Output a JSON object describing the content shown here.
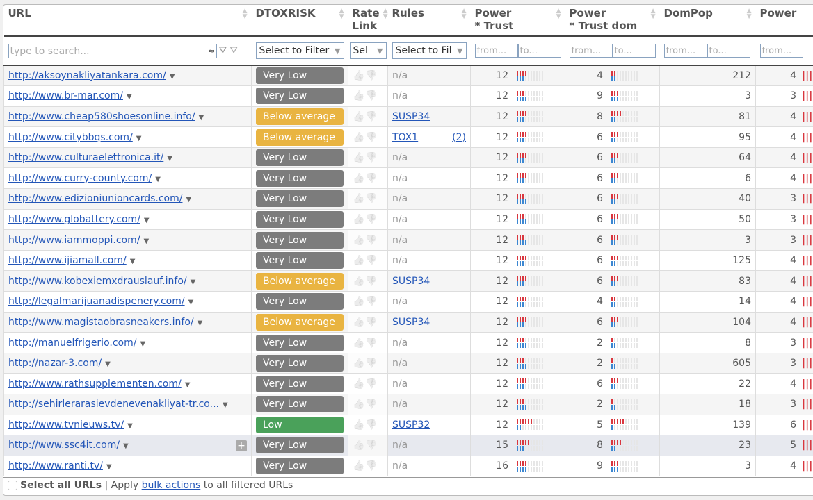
{
  "colors": {
    "very_low": "#7c7c7c",
    "below_average": "#e9b441",
    "low": "#4aa15a",
    "meter_red": "#d9363e",
    "meter_blue": "#3b86d1"
  },
  "columns": [
    "URL",
    "DTOXRISK",
    "Rate\nLink",
    "Rules",
    "Power\n* Trust",
    "Power\n* Trust dom",
    "DomPop",
    "Power"
  ],
  "filters": {
    "search_placeholder": "type to search...",
    "approx_icon": "≈",
    "select_filter": "Select to Filter",
    "select_short": "Sel",
    "select_rules": "Select to Fil",
    "from": "from...",
    "to": "to..."
  },
  "rows": [
    {
      "url": "http://aksoynakliyatankara.com/",
      "risk": "Very Low",
      "level": "very_low",
      "rules": "n/a",
      "pt": 12,
      "pt_r": 4,
      "pt_b": 3,
      "ptd": 4,
      "ptd_r": 2,
      "ptd_b": 2,
      "dompop": 212,
      "power": 4
    },
    {
      "url": "http://www.br-mar.com/",
      "risk": "Very Low",
      "level": "very_low",
      "rules": "n/a",
      "pt": 12,
      "pt_r": 3,
      "pt_b": 4,
      "ptd": 9,
      "ptd_r": 3,
      "ptd_b": 3,
      "dompop": 3,
      "power": 3
    },
    {
      "url": "http://www.cheap580shoesonline.info/",
      "risk": "Below average",
      "level": "below_average",
      "rules": "SUSP34",
      "pt": 12,
      "pt_r": 4,
      "pt_b": 3,
      "ptd": 8,
      "ptd_r": 4,
      "ptd_b": 2,
      "dompop": 81,
      "power": 4
    },
    {
      "url": "http://www.citybbqs.com/",
      "risk": "Below average",
      "level": "below_average",
      "rules": "TOX1",
      "rules_count": "(2)",
      "pt": 12,
      "pt_r": 4,
      "pt_b": 3,
      "ptd": 6,
      "ptd_r": 3,
      "ptd_b": 2,
      "dompop": 95,
      "power": 4
    },
    {
      "url": "http://www.culturaelettronica.it/",
      "risk": "Very Low",
      "level": "very_low",
      "rules": "n/a",
      "pt": 12,
      "pt_r": 4,
      "pt_b": 3,
      "ptd": 6,
      "ptd_r": 3,
      "ptd_b": 2,
      "dompop": 64,
      "power": 4
    },
    {
      "url": "http://www.curry-county.com/",
      "risk": "Very Low",
      "level": "very_low",
      "rules": "n/a",
      "pt": 12,
      "pt_r": 4,
      "pt_b": 3,
      "ptd": 6,
      "ptd_r": 3,
      "ptd_b": 2,
      "dompop": 6,
      "power": 4
    },
    {
      "url": "http://www.edizioniunioncards.com/",
      "risk": "Very Low",
      "level": "very_low",
      "rules": "n/a",
      "pt": 12,
      "pt_r": 3,
      "pt_b": 4,
      "ptd": 6,
      "ptd_r": 3,
      "ptd_b": 2,
      "dompop": 40,
      "power": 3
    },
    {
      "url": "http://www.globattery.com/",
      "risk": "Very Low",
      "level": "very_low",
      "rules": "n/a",
      "pt": 12,
      "pt_r": 3,
      "pt_b": 4,
      "ptd": 6,
      "ptd_r": 3,
      "ptd_b": 2,
      "dompop": 50,
      "power": 3
    },
    {
      "url": "http://www.iammoppi.com/",
      "risk": "Very Low",
      "level": "very_low",
      "rules": "n/a",
      "pt": 12,
      "pt_r": 3,
      "pt_b": 4,
      "ptd": 6,
      "ptd_r": 3,
      "ptd_b": 2,
      "dompop": 3,
      "power": 3
    },
    {
      "url": "http://www.ijiamall.com/",
      "risk": "Very Low",
      "level": "very_low",
      "rules": "n/a",
      "pt": 12,
      "pt_r": 4,
      "pt_b": 3,
      "ptd": 6,
      "ptd_r": 3,
      "ptd_b": 2,
      "dompop": 125,
      "power": 4
    },
    {
      "url": "http://www.kobexiemxdrauslauf.info/",
      "risk": "Below average",
      "level": "below_average",
      "rules": "SUSP34",
      "pt": 12,
      "pt_r": 4,
      "pt_b": 3,
      "ptd": 6,
      "ptd_r": 3,
      "ptd_b": 2,
      "dompop": 83,
      "power": 4
    },
    {
      "url": "http://legalmarijuanadispenery.com/",
      "risk": "Very Low",
      "level": "very_low",
      "rules": "n/a",
      "pt": 12,
      "pt_r": 4,
      "pt_b": 3,
      "ptd": 4,
      "ptd_r": 2,
      "ptd_b": 2,
      "dompop": 14,
      "power": 4
    },
    {
      "url": "http://www.magistaobrasneakers.info/",
      "risk": "Below average",
      "level": "below_average",
      "rules": "SUSP34",
      "pt": 12,
      "pt_r": 4,
      "pt_b": 3,
      "ptd": 6,
      "ptd_r": 3,
      "ptd_b": 2,
      "dompop": 104,
      "power": 4
    },
    {
      "url": "http://manuelfrigerio.com/",
      "risk": "Very Low",
      "level": "very_low",
      "rules": "n/a",
      "pt": 12,
      "pt_r": 3,
      "pt_b": 4,
      "ptd": 2,
      "ptd_r": 1,
      "ptd_b": 2,
      "dompop": 8,
      "power": 3
    },
    {
      "url": "http://nazar-3.com/",
      "risk": "Very Low",
      "level": "very_low",
      "rules": "n/a",
      "pt": 12,
      "pt_r": 3,
      "pt_b": 4,
      "ptd": 2,
      "ptd_r": 1,
      "ptd_b": 2,
      "dompop": 605,
      "power": 3
    },
    {
      "url": "http://www.rathsupplementen.com/",
      "risk": "Very Low",
      "level": "very_low",
      "rules": "n/a",
      "pt": 12,
      "pt_r": 4,
      "pt_b": 3,
      "ptd": 6,
      "ptd_r": 3,
      "ptd_b": 2,
      "dompop": 22,
      "power": 4
    },
    {
      "url": "http://sehirlerarasievdenevenakliyat-tr.co...",
      "risk": "Very Low",
      "level": "very_low",
      "rules": "n/a",
      "pt": 12,
      "pt_r": 3,
      "pt_b": 4,
      "ptd": 2,
      "ptd_r": 1,
      "ptd_b": 2,
      "dompop": 18,
      "power": 3
    },
    {
      "url": "http://www.tvnieuws.tv/",
      "risk": "Low",
      "level": "low",
      "rules": "SUSP32",
      "pt": 12,
      "pt_r": 6,
      "pt_b": 2,
      "ptd": 5,
      "ptd_r": 5,
      "ptd_b": 1,
      "dompop": 139,
      "power": 6
    },
    {
      "url": "http://www.ssc4it.com/",
      "risk": "Very Low",
      "level": "very_low",
      "rules": "n/a",
      "pt": 15,
      "pt_r": 5,
      "pt_b": 3,
      "ptd": 8,
      "ptd_r": 4,
      "ptd_b": 2,
      "dompop": 23,
      "power": 5,
      "highlighted": true
    },
    {
      "url": "http://www.ranti.tv/",
      "risk": "Very Low",
      "level": "very_low",
      "rules": "n/a",
      "pt": 16,
      "pt_r": 4,
      "pt_b": 4,
      "ptd": 9,
      "ptd_r": 3,
      "ptd_b": 3,
      "dompop": 3,
      "power": 4
    }
  ],
  "footer": {
    "select_all": "Select all URLs",
    "sep": " | Apply ",
    "bulk": "bulk actions",
    "rest": " to all filtered URLs"
  }
}
